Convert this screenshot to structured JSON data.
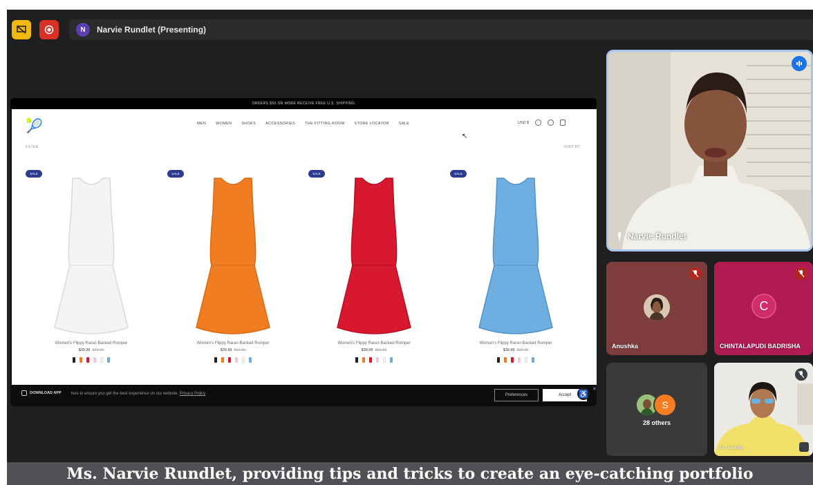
{
  "topbar": {
    "presenter_initial": "N",
    "presenting_label": "Narvie Rundlet (Presenting)"
  },
  "shared_screen": {
    "announcement": "ORDERS $50 OR MORE RECEIVE FREE U.S. SHIPPING",
    "nav": [
      "MEN",
      "WOMEN",
      "SHOES",
      "ACCESSORIES",
      "THE FITTING ROOM",
      "STORE LOCATOR",
      "SALE"
    ],
    "currency": "USD $",
    "filter_label": "FILTER",
    "sort_label": "SORT BY",
    "products": [
      {
        "badge": "SALE",
        "name": "Women's Flippy Racer-Backed Romper",
        "price": "$39.99",
        "old_price": "$69.99",
        "color": "#f4f4f4"
      },
      {
        "badge": "SALE",
        "name": "Women's Flippy Racer-Backed Romper",
        "price": "$39.99",
        "old_price": "$69.99",
        "color": "#f07d22"
      },
      {
        "badge": "SALE",
        "name": "Women's Flippy Racer-Backed Romper",
        "price": "$39.99",
        "old_price": "$69.99",
        "color": "#d8182f"
      },
      {
        "badge": "SALE",
        "name": "Women's Flippy Racer-Backed Romper",
        "price": "$39.99",
        "old_price": "$69.99",
        "color": "#6eaee0"
      }
    ],
    "swatch_colors": [
      "#222222",
      "#f07d22",
      "#d8182f",
      "#f2c6d4",
      "#f4f4f4",
      "#6eaee0"
    ],
    "cookie": {
      "download_app": "DOWNLOAD APP",
      "message": "kies to ensure you get the best experience on our website.",
      "privacy_link": "Privacy Policy",
      "preferences": "Preferences",
      "accept": "Accept"
    }
  },
  "participants": {
    "speaker": "Narvie Rundlet",
    "tile1": "Anushka",
    "tile2": "CHINTALAPUDI BADRISHA",
    "tile2_initial": "C",
    "others_initial": "S",
    "others": "28 others",
    "tile4": "Dr. Anusha"
  },
  "caption": "Ms. Narvie Rundlet, providing tips and tricks to create an eye-catching portfolio"
}
